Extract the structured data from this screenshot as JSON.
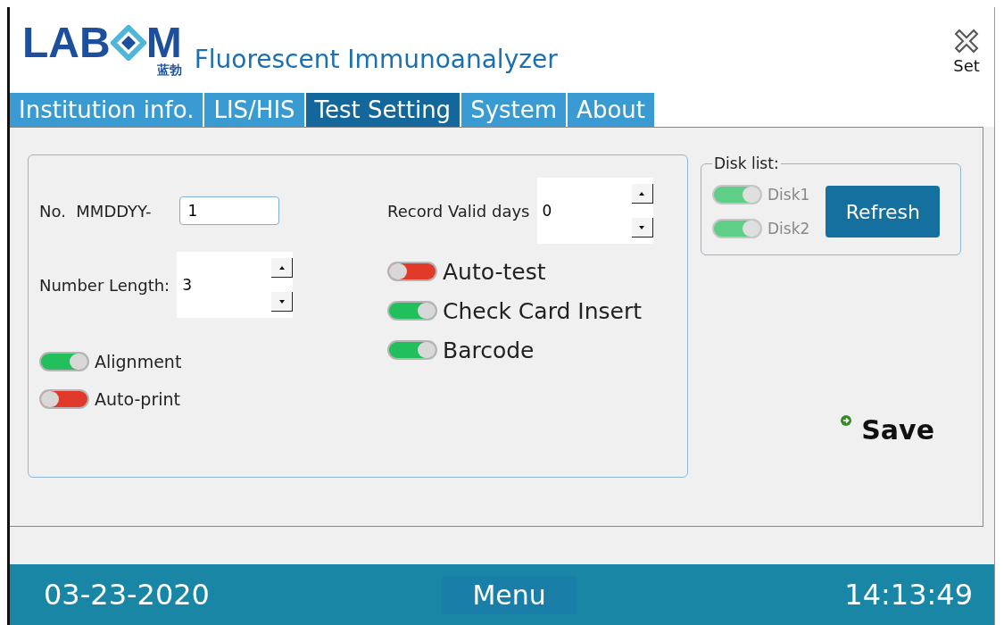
{
  "header": {
    "logo": "LAB",
    "logo_tail": "M",
    "logo_sub": "蓝勃",
    "title": "Fluorescent Immunoanalyzer",
    "set_button": "Set"
  },
  "tabs": [
    {
      "label": "Institution info.",
      "selected": false
    },
    {
      "label": "LIS/HIS",
      "selected": false
    },
    {
      "label": "Test Setting",
      "selected": true
    },
    {
      "label": "System",
      "selected": false
    },
    {
      "label": "About",
      "selected": false
    }
  ],
  "left_fields": [
    {
      "kind": "text",
      "label": "No.  MMDDYY-",
      "value": "1"
    },
    {
      "kind": "spin",
      "label": "Number Length:",
      "value": "3"
    }
  ],
  "left_switches": [
    {
      "label": "Alignment",
      "on": true
    },
    {
      "label": "Auto-print",
      "on": false
    }
  ],
  "right_fields": [
    {
      "kind": "spin",
      "label": "Record Valid days",
      "value": "0"
    }
  ],
  "right_switches": [
    {
      "label": "Auto-test",
      "on": false
    },
    {
      "label": "Check Card Insert",
      "on": true
    },
    {
      "label": "Barcode",
      "on": true
    }
  ],
  "disk_list": {
    "title": "Disk list:",
    "disks": [
      {
        "label": "Disk1",
        "on": true,
        "disabled": true
      },
      {
        "label": "Disk2",
        "on": true,
        "disabled": true
      }
    ],
    "refresh": "Refresh"
  },
  "save": "Save",
  "status_bar": {
    "date": "03-23-2020",
    "menu": "Menu",
    "time": "14:13:49"
  }
}
